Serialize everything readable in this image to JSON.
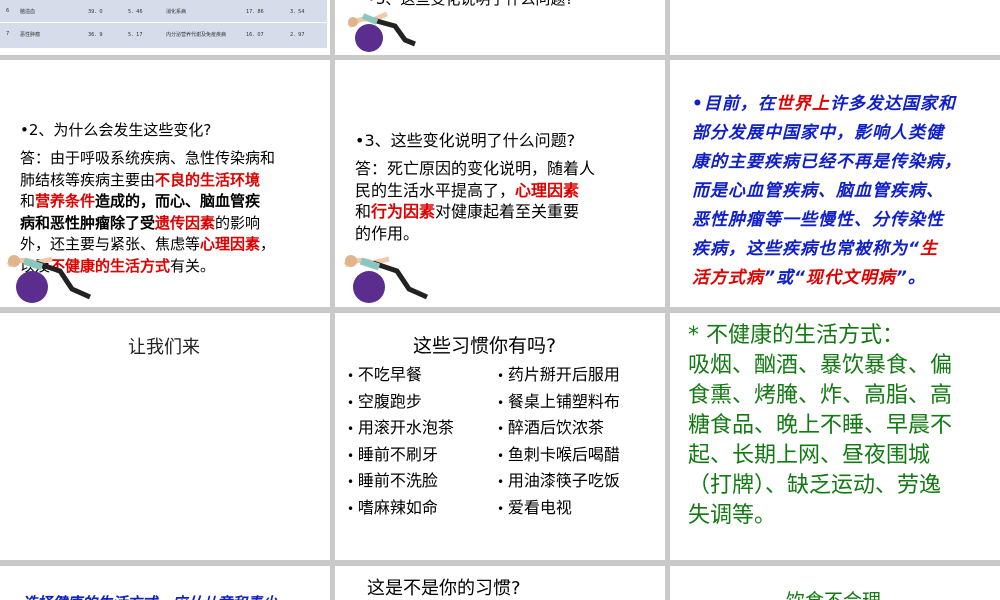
{
  "table": {
    "rows": [
      {
        "rank": "6",
        "name": "脑溢血",
        "v1": "39．0",
        "v2": "5．46",
        "name2": "消化系病",
        "v3": "17．86",
        "v4": "3．54"
      },
      {
        "rank": "7",
        "name": "恶性肿瘤",
        "v1": "36．9",
        "v2": "5．17",
        "name2": "内分泌营养代谢及免疫疾病",
        "v3": "16．07",
        "v4": "2．97"
      }
    ]
  },
  "slide_top_middle": {
    "question": "•3、这些变化说明了什么问题?"
  },
  "slide_q2": {
    "question": "•2、为什么会发生这些变化?",
    "answer_lines": [
      [
        {
          "t": "答：由于呼吸系统疾病、急性传染病和"
        }
      ],
      [
        {
          "t": "肺结核等疾病主要由"
        },
        {
          "t": "不良的生活环境",
          "c": "red"
        }
      ],
      [
        {
          "t": "和"
        },
        {
          "t": "营养条件",
          "c": "red"
        },
        {
          "t": "造成的，而心、脑血管疾",
          "c": "bold"
        }
      ],
      [
        {
          "t": "病和恶性肿瘤除了受",
          "c": "bold"
        },
        {
          "t": "遗传因素",
          "c": "red"
        },
        {
          "t": "的影响"
        }
      ],
      [
        {
          "t": "外，还主要与紧张、焦虑等"
        },
        {
          "t": "心理因素",
          "c": "red"
        },
        {
          "t": "，"
        }
      ],
      [
        {
          "t": "以及"
        },
        {
          "t": "不健康的生活方式",
          "c": "red"
        },
        {
          "t": "有关。"
        }
      ]
    ]
  },
  "slide_q3": {
    "question": "•3、这些变化说明了什么问题?",
    "answer_lines": [
      [
        {
          "t": "答：死亡原因的变化说明，随着人"
        }
      ],
      [
        {
          "t": "民的生活水平提高了，"
        },
        {
          "t": "心理因素",
          "c": "red"
        }
      ],
      [
        {
          "t": "和"
        },
        {
          "t": "行为因素",
          "c": "red"
        },
        {
          "t": "对健康起着至关重要"
        }
      ],
      [
        {
          "t": "的作用。"
        }
      ]
    ]
  },
  "slide_blue": {
    "lines": [
      [
        {
          "t": "•目前，在"
        },
        {
          "t": "世界上",
          "c": "r"
        },
        {
          "t": "许多发达国家和"
        }
      ],
      [
        {
          "t": "部分发展中国家中，影响人类健"
        }
      ],
      [
        {
          "t": "康的主要疾病已经不再是传染病，"
        }
      ],
      [
        {
          "t": "而是心血管疾病、脑血管疾病、"
        }
      ],
      [
        {
          "t": "恶性肿瘤等一些慢性、分传染性"
        }
      ],
      [
        {
          "t": "疾病，这些疾病也常被称为“"
        },
        {
          "t": "生",
          "c": "r"
        }
      ],
      [
        {
          "t": "活方式病",
          "c": "r"
        },
        {
          "t": "”或“"
        },
        {
          "t": "现代文明病",
          "c": "r"
        },
        {
          "t": "”。"
        }
      ]
    ]
  },
  "slide_letus": {
    "text": "让我们来"
  },
  "slide_habits": {
    "title": "这些习惯你有吗?",
    "left": [
      "不吃早餐",
      "空腹跑步",
      "用滚开水泡茶",
      "睡前不刷牙",
      "睡前不洗脸",
      "嗜麻辣如命"
    ],
    "right": [
      "药片掰开后服用",
      "餐桌上铺塑料布",
      "醉酒后饮浓茶",
      "鱼刺卡喉后喝醋",
      "用油漆筷子吃饭",
      "爱看电视"
    ]
  },
  "slide_green": {
    "lines": [
      "* 不健康的生活方式：",
      "吸烟、酗酒、暴饮暴食、偏",
      "食熏、烤腌、炸、高脂、高",
      "糖食品、晚上不睡、早晨不",
      "起、长期上网、昼夜围城",
      "（打牌）、缺乏运动、劳逸",
      "失调等。"
    ]
  },
  "slide_bottom_left": {
    "text": "选择健康的生活方式，应从儿童和青少"
  },
  "slide_bottom_middle": {
    "text": "这是不是你的习惯?"
  },
  "slide_bottom_right": {
    "text": "饮食不合理"
  },
  "colors": {
    "red": "#e00000",
    "blue": "#1020c8",
    "green": "#137a13",
    "ball": "#5a2d8f"
  }
}
